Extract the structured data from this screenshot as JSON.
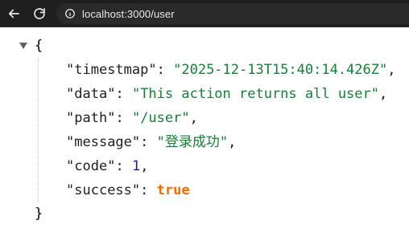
{
  "browser": {
    "url": "localhost:3000/user"
  },
  "json": {
    "open_brace": "{",
    "close_brace": "}",
    "entries": [
      {
        "key": "timestmap",
        "value": "2025-12-13T15:40:14.426Z",
        "type": "string"
      },
      {
        "key": "data",
        "value": "This action returns all user",
        "type": "string"
      },
      {
        "key": "path",
        "value": "/user",
        "type": "string"
      },
      {
        "key": "message",
        "value": "登录成功",
        "type": "string"
      },
      {
        "key": "code",
        "value": "1",
        "type": "number"
      },
      {
        "key": "success",
        "value": "true",
        "type": "boolean"
      }
    ]
  },
  "icons": {
    "back": "back-arrow-icon",
    "reload": "reload-icon",
    "info": "info-icon",
    "toggle": "collapse-triangle-icon"
  },
  "colors": {
    "string": "#188038",
    "number": "#1a1aa6",
    "boolean": "#f36b00",
    "toolbar_bg": "#1f1f1f",
    "omnibox_bg": "#2a2a2a"
  }
}
